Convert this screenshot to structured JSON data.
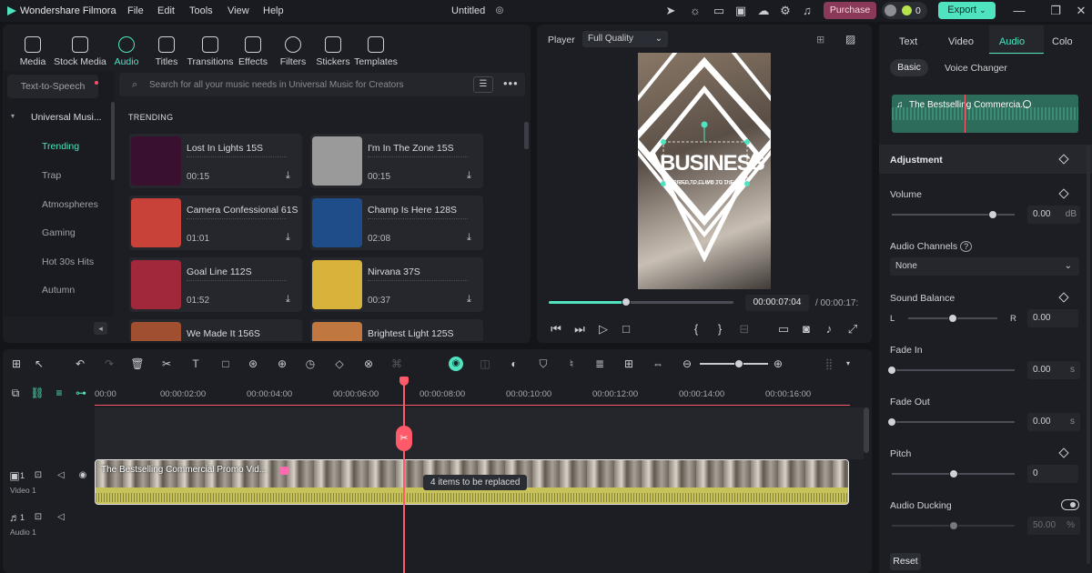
{
  "app": {
    "name": "Wondershare Filmora",
    "menu": [
      "File",
      "Edit",
      "Tools",
      "View",
      "Help"
    ],
    "doc_title": "Untitled",
    "purchase_label": "Purchase",
    "credits": "0",
    "export_label": "Export"
  },
  "media_tabs": [
    "Media",
    "Stock Media",
    "Audio",
    "Titles",
    "Transitions",
    "Effects",
    "Filters",
    "Stickers",
    "Templates"
  ],
  "sidebar": {
    "tts": "Text-to-Speech",
    "group": "Universal Musi...",
    "items": [
      "Trending",
      "Trap",
      "Atmospheres",
      "Gaming",
      "Hot 30s Hits",
      "Autumn"
    ]
  },
  "search": {
    "placeholder": "Search for all your music needs in Universal Music for Creators"
  },
  "section_label": "TRENDING",
  "tracks": [
    {
      "name": "Lost In Lights 15S",
      "duration": "00:15",
      "color": "#3a1030"
    },
    {
      "name": "I'm In The Zone 15S",
      "duration": "00:15",
      "color": "#9a9a9a"
    },
    {
      "name": "Camera Confessional 61S",
      "duration": "01:01",
      "color": "#c8423a"
    },
    {
      "name": "Champ Is Here 128S",
      "duration": "02:08",
      "color": "#1e4d8a"
    },
    {
      "name": "Goal Line 112S",
      "duration": "01:52",
      "color": "#a0283a"
    },
    {
      "name": "Nirvana 37S",
      "duration": "00:37",
      "color": "#d8b23a"
    },
    {
      "name": "We Made It 156S",
      "duration": "",
      "color": "#a05030"
    },
    {
      "name": "Brightest Light 125S",
      "duration": "",
      "color": "#c07840"
    }
  ],
  "player": {
    "label": "Player",
    "quality": "Full Quality",
    "current_time": "00:00:07:04",
    "total_time": "/ 00:00:17:",
    "progress": 0.42,
    "video_title": "BUSINESS",
    "video_subtitle": "INSPIRED TO CLIMB TO THE TOP"
  },
  "timeline": {
    "ruler": [
      "00:00",
      "00:00:02:00",
      "00:00:04:00",
      "00:00:06:00",
      "00:00:08:00",
      "00:00:10:00",
      "00:00:12:00",
      "00:00:14:00",
      "00:00:16:00"
    ],
    "clip_title": "The Bestselling Commercial Promo Vid...",
    "clip_badge": "4 items to be replaced",
    "video_track": "Video 1",
    "audio_track": "Audio 1",
    "video_track_num": "1",
    "audio_track_num": "1"
  },
  "right": {
    "tabs": [
      "Text",
      "Video",
      "Audio",
      "Colo"
    ],
    "subtabs": [
      "Basic",
      "Voice Changer"
    ],
    "audio_clip": "The Bestselling Commercia...",
    "adjustment": "Adjustment",
    "volume": {
      "label": "Volume",
      "value": "0.00",
      "unit": "dB",
      "level": 0.82
    },
    "channels": {
      "label": "Audio Channels",
      "value": "None"
    },
    "balance": {
      "label": "Sound Balance",
      "left": "L",
      "right": "R",
      "value": "0.00",
      "level": 0.5
    },
    "fade_in": {
      "label": "Fade In",
      "value": "0.00",
      "unit": "s",
      "level": 0.0
    },
    "fade_out": {
      "label": "Fade Out",
      "value": "0.00",
      "unit": "s",
      "level": 0.0
    },
    "pitch": {
      "label": "Pitch",
      "value": "0",
      "level": 0.5
    },
    "ducking": {
      "label": "Audio Ducking",
      "value": "50.00",
      "unit": "%",
      "level": 0.5
    },
    "reset": "Reset"
  }
}
